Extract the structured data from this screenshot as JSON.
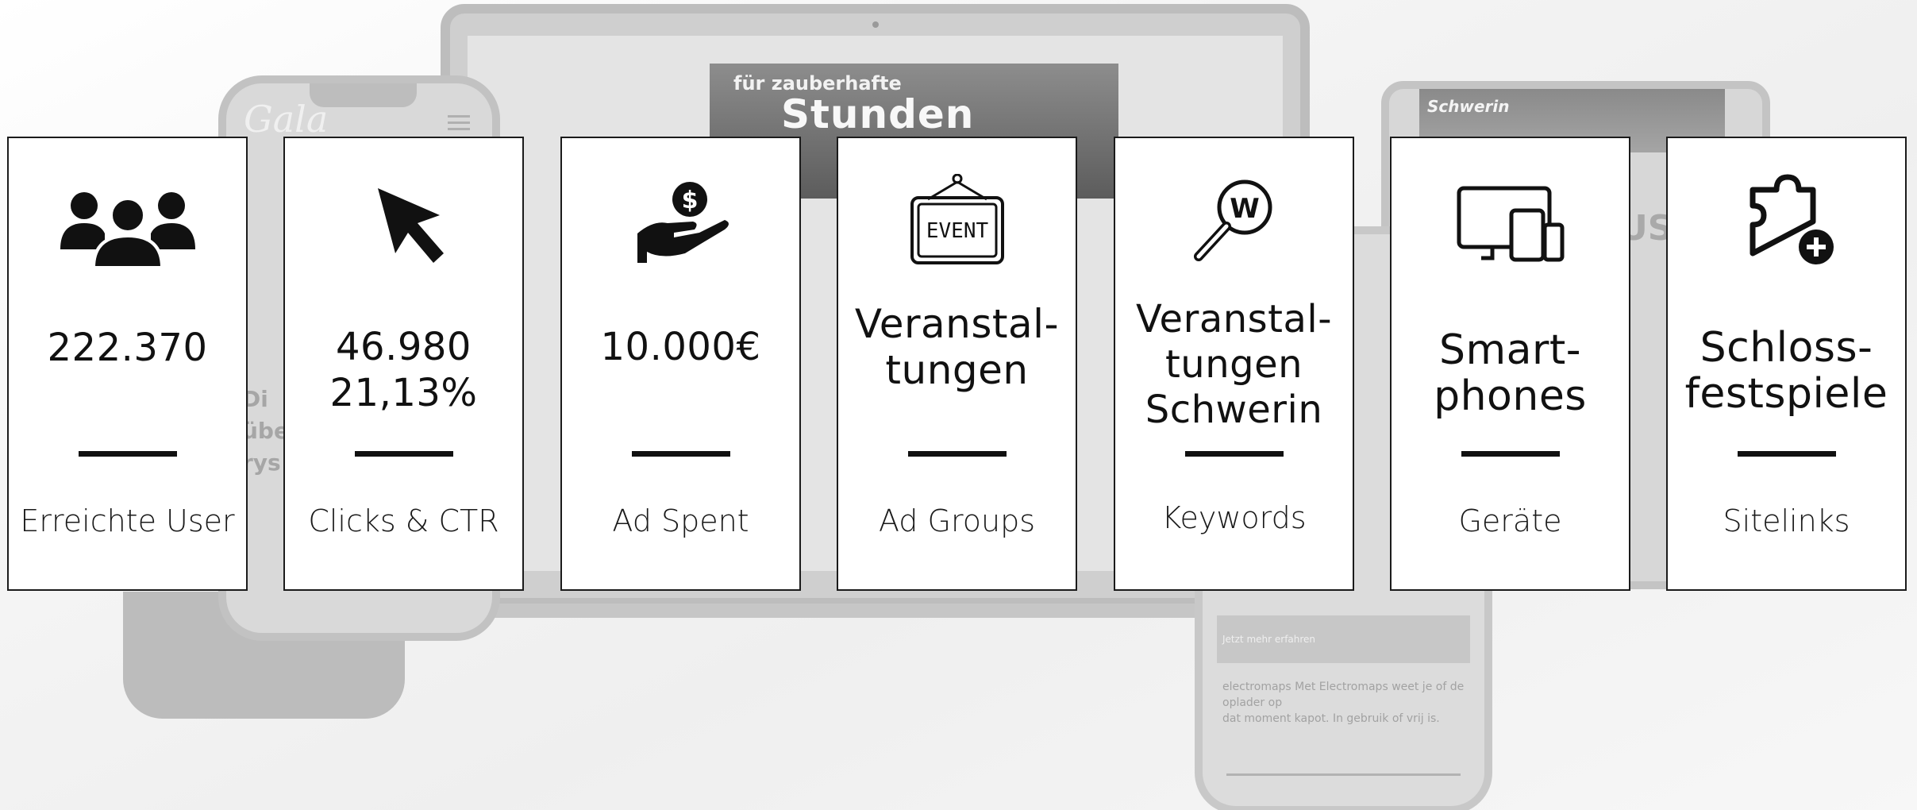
{
  "background": {
    "laptop_headline_small": "für zauberhafte",
    "laptop_headline_large": "Stunden",
    "phone_left_logo": "Gala",
    "phone_left_text": "Di\nübe\nrys",
    "tablet_label": "Schwerin",
    "tablet_text": "US",
    "phone_right_text": "electromaps Met Electromaps weet je of de oplader op\ndat moment kapot. In gebruik of vrij is.",
    "phone_right_caption": "Jetzt mehr erfahren"
  },
  "cards": [
    {
      "icon": "users-group-icon",
      "value": "222.370",
      "label": "Erreichte User"
    },
    {
      "icon": "cursor-arrow-icon",
      "value": "46.980\n21,13%",
      "label": "Clicks & CTR"
    },
    {
      "icon": "money-hand-icon",
      "value": "10.000€",
      "label": "Ad Spent"
    },
    {
      "icon": "event-sign-icon",
      "value": "Veranstal-\ntungen",
      "label": "Ad Groups"
    },
    {
      "icon": "keyword-search-icon",
      "value": "Veranstal-\ntungen\nSchwerin",
      "label": "Keywords"
    },
    {
      "icon": "devices-icon",
      "value": "Smart-\nphones",
      "label": "Geräte"
    },
    {
      "icon": "puzzle-plus-icon",
      "value": "Schloss-\nfestspiele",
      "label": "Sitelinks"
    }
  ],
  "colors": {
    "card_border": "#1b1b1b",
    "card_bg": "#ffffff",
    "text": "#111111",
    "background": "#f3f3f3"
  }
}
